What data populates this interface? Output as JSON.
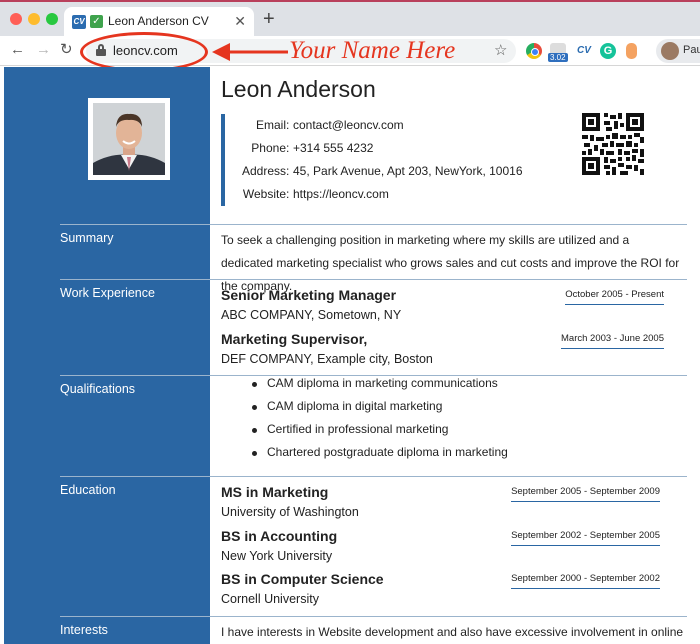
{
  "browser": {
    "tab_title": "Leon Anderson CV",
    "tab_favicon": "CV",
    "url": "leoncv.com",
    "annotation": "Your Name Here",
    "profile_name": "Pau",
    "speed_badge": "3.02",
    "ext_cv": "CV",
    "ext_g": "G"
  },
  "cv": {
    "name": "Leon Anderson",
    "contact": [
      {
        "label": "Email",
        "value": "contact@leoncv.com"
      },
      {
        "label": "Phone",
        "value": "+314 555 4232"
      },
      {
        "label": "Address",
        "value": "45, Park Avenue, Apt 203, NewYork, 10016"
      },
      {
        "label": "Website",
        "value": "https://leoncv.com"
      }
    ],
    "sections": {
      "summary": "Summary",
      "work": "Work Experience",
      "qualifications": "Qualifications",
      "education": "Education",
      "interests": "Interests"
    },
    "summary_text": "To seek a challenging position in marketing where my skills are utilized and a dedicated marketing specialist who grows sales and cut costs and improve the ROI for the company.",
    "work": [
      {
        "title": "Senior Marketing Manager",
        "company": "ABC COMPANY, Sometown, NY",
        "dates": "October 2005 - Present"
      },
      {
        "title": "Marketing Supervisor,",
        "company": "DEF COMPANY, Example city, Boston",
        "dates": "March 2003 - June 2005"
      }
    ],
    "qualifications": [
      "CAM diploma in marketing communications",
      "CAM diploma in digital marketing",
      "Certified in professional marketing",
      "Chartered postgraduate diploma in marketing"
    ],
    "education": [
      {
        "degree": "MS in Marketing",
        "school": "University of Washington",
        "dates": "September 2005 - September 2009"
      },
      {
        "degree": "BS in Accounting",
        "school": "New York University",
        "dates": "September 2002 - September 2005"
      },
      {
        "degree": "BS in Computer Science",
        "school": "Cornell University",
        "dates": "September 2000 - September 2002"
      }
    ],
    "interests_text": "I have interests in Website development and also have excessive involvement in online"
  },
  "colors": {
    "accent": "#2a66a3",
    "annotation": "#e5351f"
  },
  "icons": [
    "back-arrow-icon",
    "forward-arrow-icon",
    "reload-icon",
    "lock-icon",
    "star-icon",
    "close-icon",
    "plus-icon"
  ]
}
